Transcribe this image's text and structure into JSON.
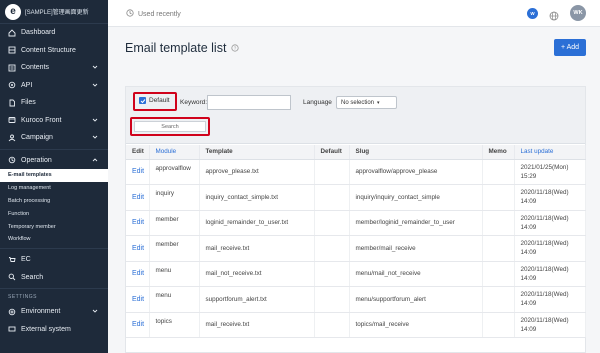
{
  "app": {
    "brand": "[SAMPLE]管理画面更新",
    "logo_letter": "e"
  },
  "sidebar": {
    "items": [
      {
        "label": "Dashboard",
        "icon": "home-icon"
      },
      {
        "label": "Content Structure",
        "icon": "content-structure-icon"
      },
      {
        "label": "Contents",
        "icon": "contents-icon"
      },
      {
        "label": "API",
        "icon": "api-icon"
      },
      {
        "label": "Files",
        "icon": "files-icon"
      },
      {
        "label": "Kuroco Front",
        "icon": "kuroco-front-icon"
      },
      {
        "label": "Campaign",
        "icon": "campaign-icon"
      },
      {
        "label": "Operation",
        "icon": "operation-icon"
      }
    ],
    "operation_sub": [
      "E-mail templates",
      "Log management",
      "Batch processing",
      "Function",
      "Temporary member",
      "Workflow"
    ],
    "lower_items": [
      {
        "label": "EC",
        "icon": "ec-icon"
      },
      {
        "label": "Search",
        "icon": "search-icon"
      }
    ],
    "settings_label": "SETTINGS",
    "settings_items": [
      {
        "label": "Environment",
        "icon": "environment-icon"
      },
      {
        "label": "External system",
        "icon": "external-system-icon"
      }
    ]
  },
  "topbar": {
    "recent_label": "Used recently",
    "badge_letter": "W",
    "avatar_initials": "WK"
  },
  "main": {
    "title": "Email template list",
    "add_label": "+ Add"
  },
  "filter": {
    "default_label": "Default",
    "keyword_label": "Keyword:",
    "keyword_value": "",
    "language_label": "Language",
    "language_value": "No selection",
    "search_label": "Search"
  },
  "table": {
    "headers": [
      "Edit",
      "Module",
      "Template",
      "Default",
      "Slug",
      "Memo",
      "Last update"
    ],
    "rows": [
      {
        "edit": "Edit",
        "module": "approvalflow",
        "template": "approve_please.txt",
        "default": "",
        "slug": "approvalflow/approve_please",
        "memo": "",
        "updated_date": "2021/01/25(Mon)",
        "updated_time": "15:29"
      },
      {
        "edit": "Edit",
        "module": "inquiry",
        "template": "inquiry_contact_simple.txt",
        "default": "",
        "slug": "inquiry/inquiry_contact_simple",
        "memo": "",
        "updated_date": "2020/11/18(Wed)",
        "updated_time": "14:09"
      },
      {
        "edit": "Edit",
        "module": "member",
        "template": "loginid_remainder_to_user.txt",
        "default": "",
        "slug": "member/loginid_remainder_to_user",
        "memo": "",
        "updated_date": "2020/11/18(Wed)",
        "updated_time": "14:09"
      },
      {
        "edit": "Edit",
        "module": "member",
        "template": "mail_receive.txt",
        "default": "",
        "slug": "member/mail_receive",
        "memo": "",
        "updated_date": "2020/11/18(Wed)",
        "updated_time": "14:09"
      },
      {
        "edit": "Edit",
        "module": "menu",
        "template": "mail_not_receive.txt",
        "default": "",
        "slug": "menu/mail_not_receive",
        "memo": "",
        "updated_date": "2020/11/18(Wed)",
        "updated_time": "14:09"
      },
      {
        "edit": "Edit",
        "module": "menu",
        "template": "supportforum_alert.txt",
        "default": "",
        "slug": "menu/supportforum_alert",
        "memo": "",
        "updated_date": "2020/11/18(Wed)",
        "updated_time": "14:09"
      },
      {
        "edit": "Edit",
        "module": "topics",
        "template": "mail_receive.txt",
        "default": "",
        "slug": "topics/mail_receive",
        "memo": "",
        "updated_date": "2020/11/18(Wed)",
        "updated_time": "14:09"
      }
    ]
  },
  "colors": {
    "sidebar_bg": "#1e2a3a",
    "accent": "#2b6fd6",
    "highlight": "#d0021b"
  }
}
